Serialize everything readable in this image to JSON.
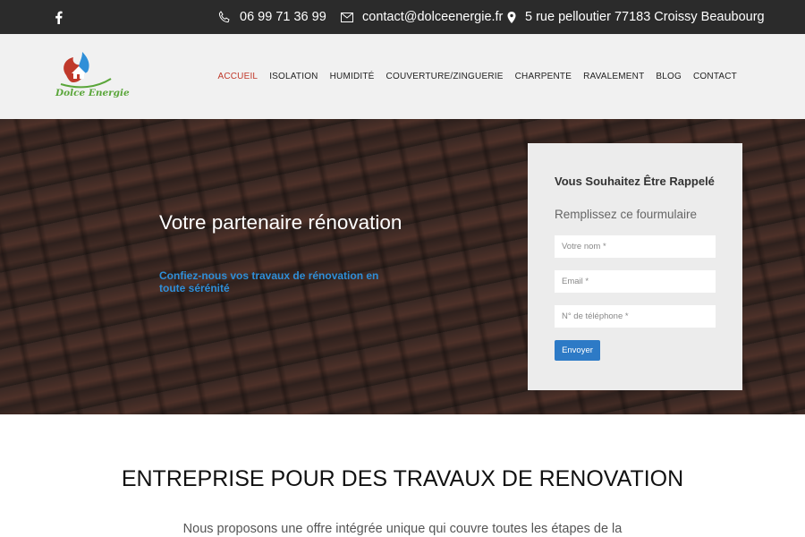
{
  "topbar": {
    "phone": "06 99 71 36 99",
    "email": "contact@dolceenergie.fr",
    "address": "5 rue pelloutier 77183 Croissy Beaubourg",
    "icons": [
      "facebook-icon",
      "phone-icon",
      "mail-icon",
      "location-pin-icon"
    ]
  },
  "header": {
    "logo_text": "Dolce Energie",
    "nav": [
      "ACCUEIL",
      "ISOLATION",
      "HUMIDITÉ",
      "COUVERTURE/ZINGUERIE",
      "CHARPENTE",
      "RAVALEMENT",
      "BLOG",
      "CONTACT"
    ],
    "active_index": 0
  },
  "hero": {
    "title": "Votre partenaire rénovation",
    "subtitle": "Confiez-nous vos travaux de rénovation en toute sérénité"
  },
  "form": {
    "title": "Vous Souhaitez Être Rappelé",
    "subtitle": "Remplissez ce fourmulaire",
    "name_placeholder": "Votre nom *",
    "email_placeholder": "Email *",
    "phone_placeholder": "N° de téléphone *",
    "submit_label": "Envoyer"
  },
  "section": {
    "title": "ENTREPRISE POUR DES TRAVAUX DE RENOVATION",
    "text": "Nous proposons une offre intégrée unique qui couvre toutes les étapes de la"
  },
  "colors": {
    "topbar_bg": "#2b2b2b",
    "header_bg": "#f1f1f1",
    "nav_active": "#c0392b",
    "accent_blue": "#2d7ac6",
    "hero_subtitle": "#2f8fd8",
    "logo_green": "#5aa63a"
  }
}
